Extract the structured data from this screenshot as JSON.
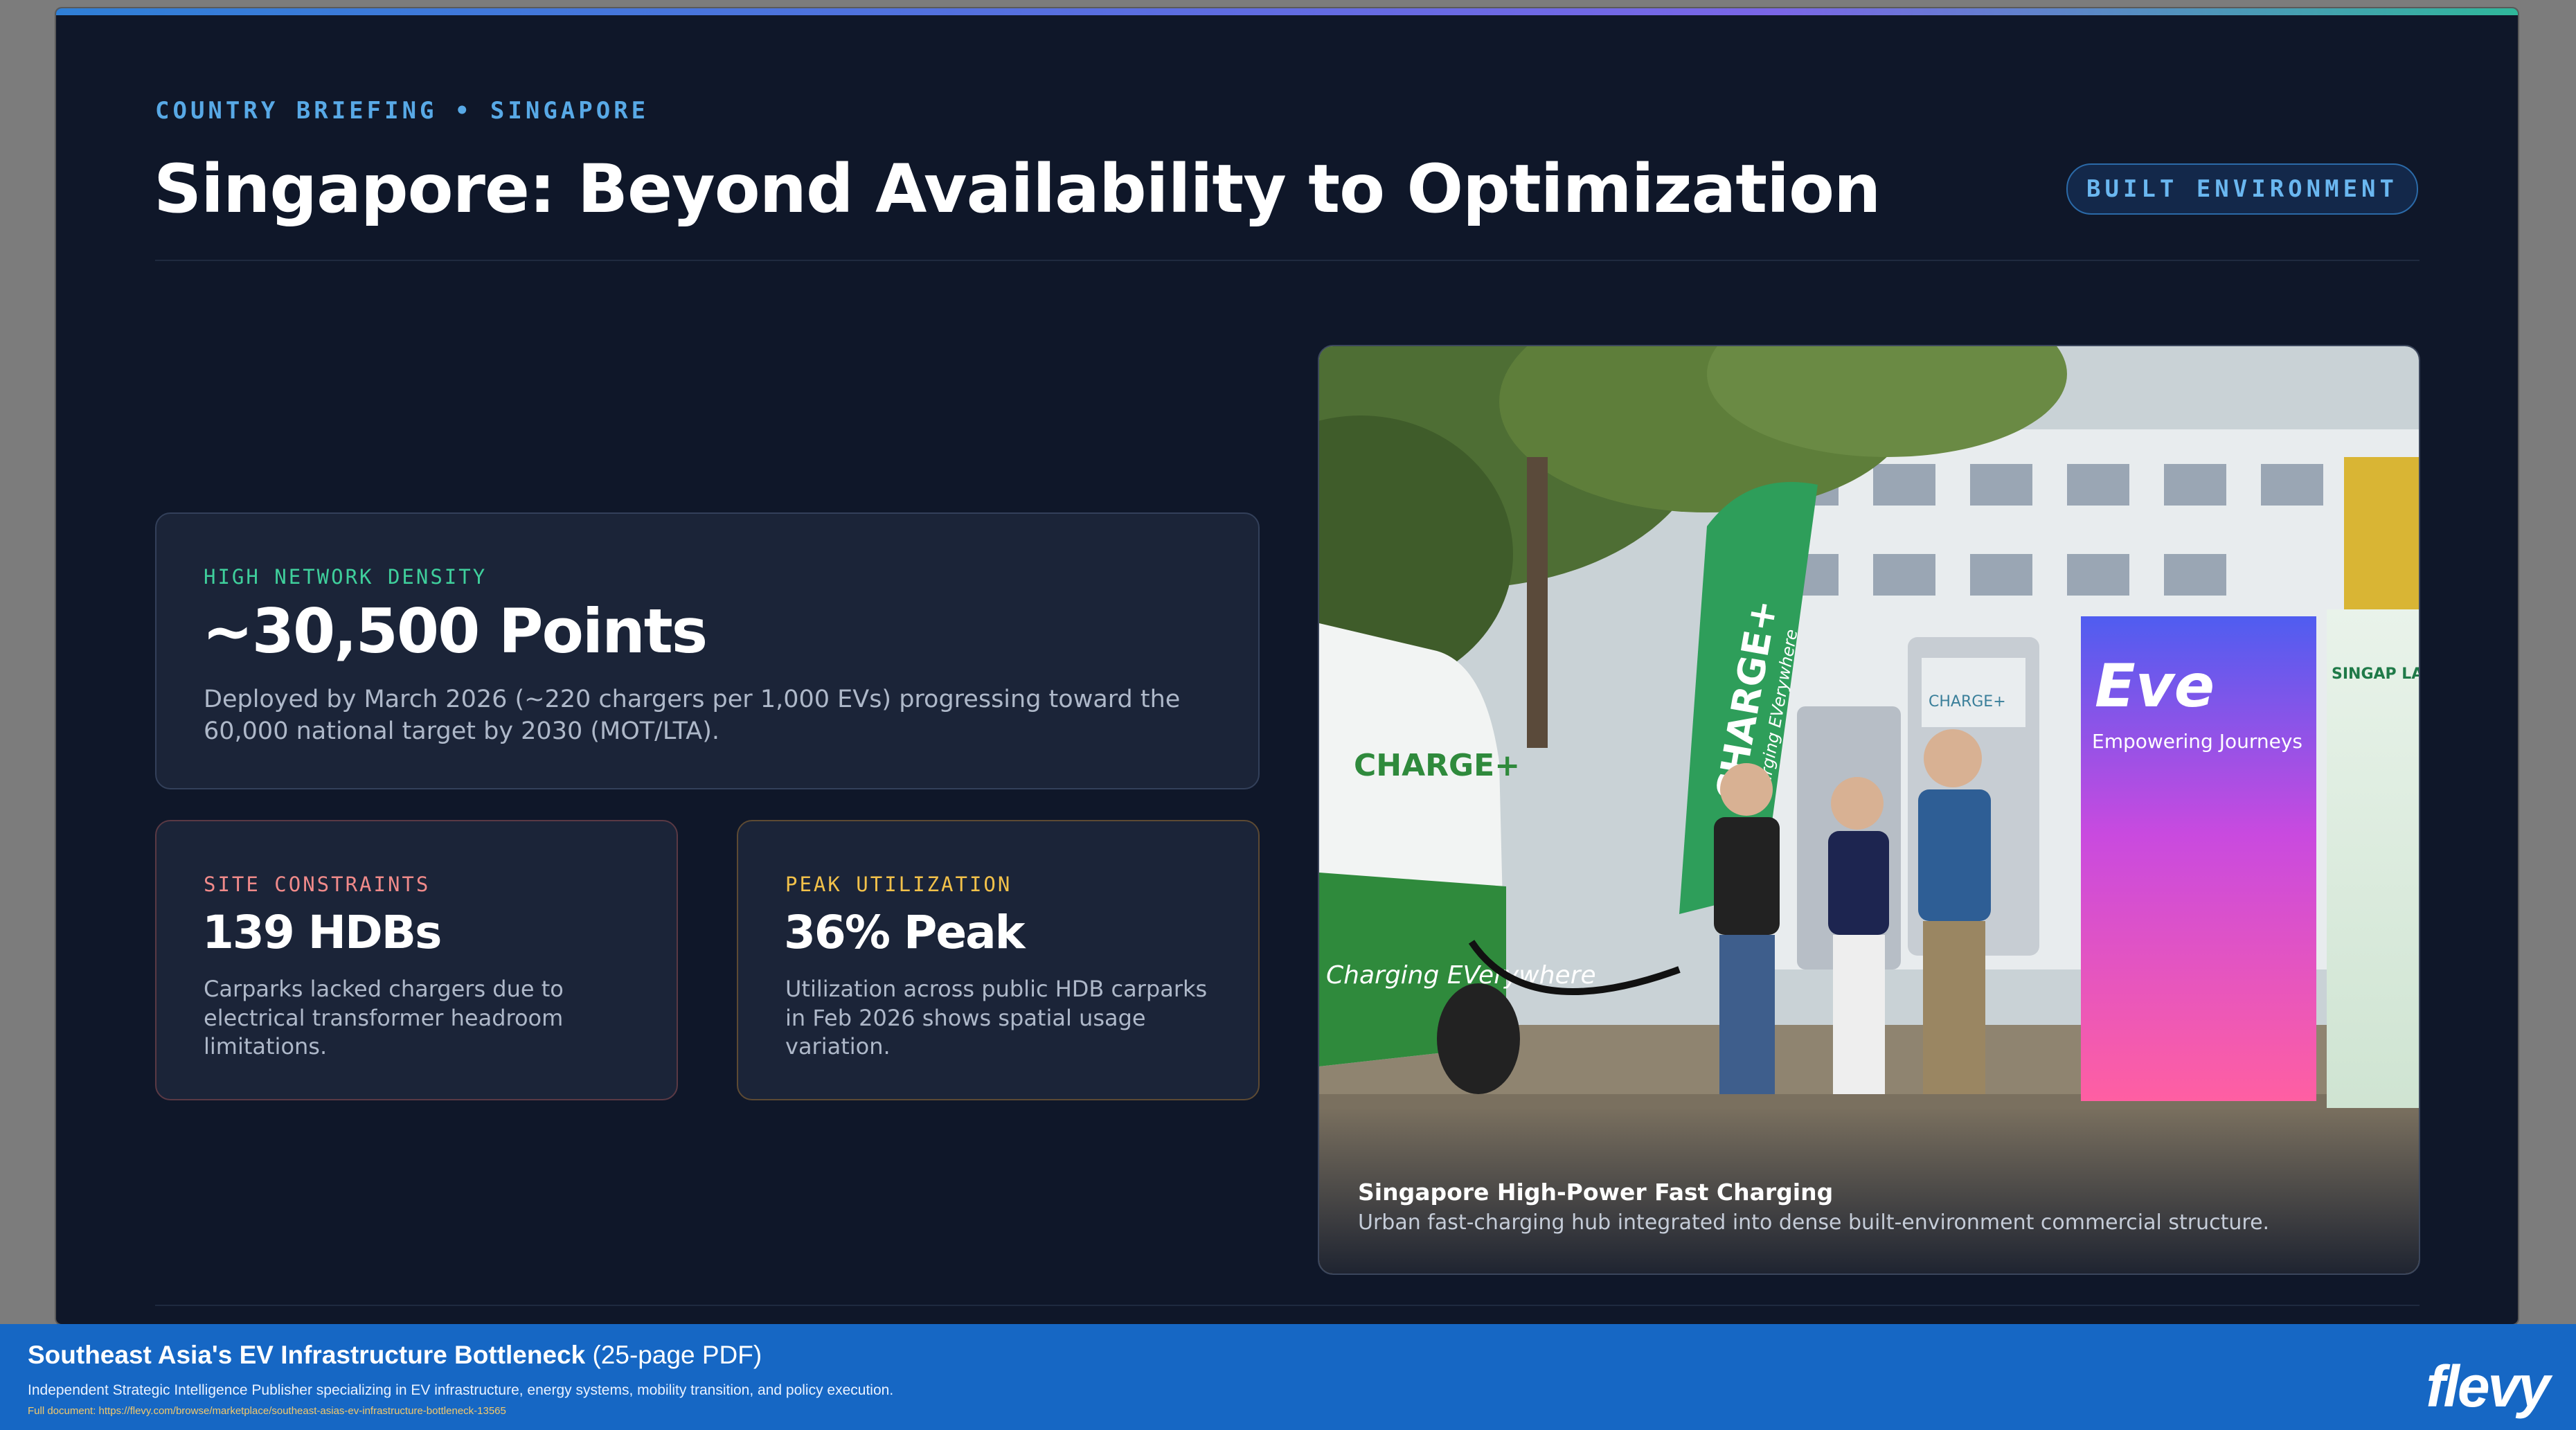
{
  "header": {
    "kicker": "COUNTRY BRIEFING • SINGAPORE",
    "title": "Singapore: Beyond Availability to Optimization",
    "badge": "BUILT ENVIRONMENT"
  },
  "cards": {
    "main": {
      "label": "HIGH NETWORK DENSITY",
      "value": "~30,500 Points",
      "desc": "Deployed by March 2026 (~220 chargers per 1,000 EVs) progressing toward the 60,000 national target by 2030 (MOT/LTA)."
    },
    "site": {
      "label": "SITE CONSTRAINTS",
      "value": "139 HDBs",
      "desc": "Carparks lacked chargers due to electrical transformer headroom limitations."
    },
    "peak": {
      "label": "PEAK UTILIZATION",
      "value": "36% Peak",
      "desc": "Utilization across public HDB carparks in Feb 2026 shows spatial usage variation."
    }
  },
  "photo": {
    "caption_title": "Singapore High-Power Fast Charging",
    "caption_sub": "Urban fast-charging hub integrated into dense built-environment commercial structure.",
    "flag_text": "CHARGE+",
    "flag_sub": "Charging EVerywhere",
    "banner_brand": "Eve",
    "banner_tagline": "Empowering Journeys",
    "van_text": "CHARGE+",
    "van_sub": "Charging EVerywhere",
    "side_banner_text": "SINGAP LARGE EV CHA OPERAT"
  },
  "footer": {
    "title": "Southeast Asia's EV Infrastructure Bottleneck",
    "title_extra": "(25-page PDF)",
    "desc": "Independent Strategic Intelligence Publisher specializing in EV infrastructure, energy systems, mobility transition, and policy execution.",
    "link": "Full document: https://flevy.com/browse/marketplace/southeast-asias-ev-infrastructure-bottleneck-13565",
    "logo": "flevy"
  },
  "colors": {
    "background": "#0f1729",
    "accent_blue": "#58a9e6",
    "accent_green": "#3fcf9c",
    "accent_red": "#f08a8a",
    "accent_yellow": "#f2c14a",
    "footer_blue": "#1667c4"
  }
}
